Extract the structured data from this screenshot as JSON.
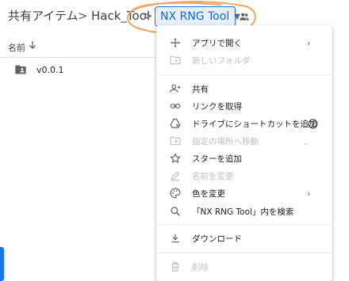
{
  "breadcrumb": {
    "root": "共有アイテム",
    "folder": "Hack_Tool",
    "current": "NX RNG Tool",
    "separator": ">"
  },
  "list": {
    "column_name": "名前",
    "rows": [
      {
        "name": "v0.0.1"
      }
    ]
  },
  "menu": {
    "items": [
      {
        "label": "アプリで開く",
        "icon": "move-icon",
        "disabled": false,
        "submenu": true
      },
      {
        "label": "新しいフォルダ",
        "icon": "new-folder-icon",
        "disabled": true
      },
      {
        "label": "共有",
        "icon": "person-add-icon",
        "disabled": false
      },
      {
        "label": "リンクを取得",
        "icon": "link-icon",
        "disabled": false
      },
      {
        "label": "ドライブにショートカットを追加",
        "icon": "add-to-drive-icon",
        "disabled": false,
        "help": true
      },
      {
        "label": "指定の場所へ移動",
        "icon": "move-to-icon",
        "disabled": true
      },
      {
        "label": "スターを追加",
        "icon": "star-icon",
        "disabled": false
      },
      {
        "label": "名前を変更",
        "icon": "pencil-icon",
        "disabled": true
      },
      {
        "label": "色を変更",
        "icon": "palette-icon",
        "disabled": false,
        "submenu": true
      },
      {
        "label": "「NX RNG Tool」内を検索",
        "icon": "search-icon",
        "disabled": false
      },
      {
        "label": "ダウンロード",
        "icon": "download-icon",
        "disabled": false
      },
      {
        "label": "削除",
        "icon": "trash-icon",
        "disabled": true
      }
    ]
  },
  "colors": {
    "accent": "#1a73e8",
    "scribble": "#f4a460",
    "disabled": "#bdc1c6"
  }
}
